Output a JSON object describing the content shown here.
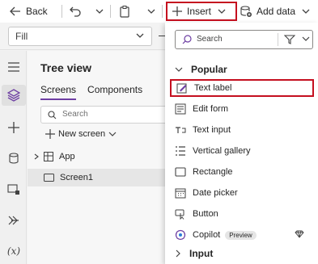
{
  "toolbar": {
    "back_label": "Back",
    "insert_label": "Insert",
    "add_data_label": "Add data"
  },
  "formula": {
    "property_value": "Fill"
  },
  "tree": {
    "title": "Tree view",
    "tabs": [
      "Screens",
      "Components"
    ],
    "search_placeholder": "Search",
    "new_screen_label": "New screen",
    "items": [
      {
        "label": "App"
      },
      {
        "label": "Screen1"
      }
    ]
  },
  "insert_panel": {
    "search_placeholder": "Search",
    "section_popular": "Popular",
    "section_input": "Input",
    "items": [
      {
        "label": "Text label",
        "icon": "text-label-icon"
      },
      {
        "label": "Edit form",
        "icon": "edit-form-icon"
      },
      {
        "label": "Text input",
        "icon": "text-input-icon"
      },
      {
        "label": "Vertical gallery",
        "icon": "vertical-gallery-icon"
      },
      {
        "label": "Rectangle",
        "icon": "rectangle-icon"
      },
      {
        "label": "Date picker",
        "icon": "date-picker-icon"
      },
      {
        "label": "Button",
        "icon": "button-icon"
      },
      {
        "label": "Copilot",
        "icon": "copilot-icon",
        "badge": "Preview"
      }
    ]
  },
  "colors": {
    "highlight": "#c50f1f",
    "accent": "#6e3fa3"
  }
}
